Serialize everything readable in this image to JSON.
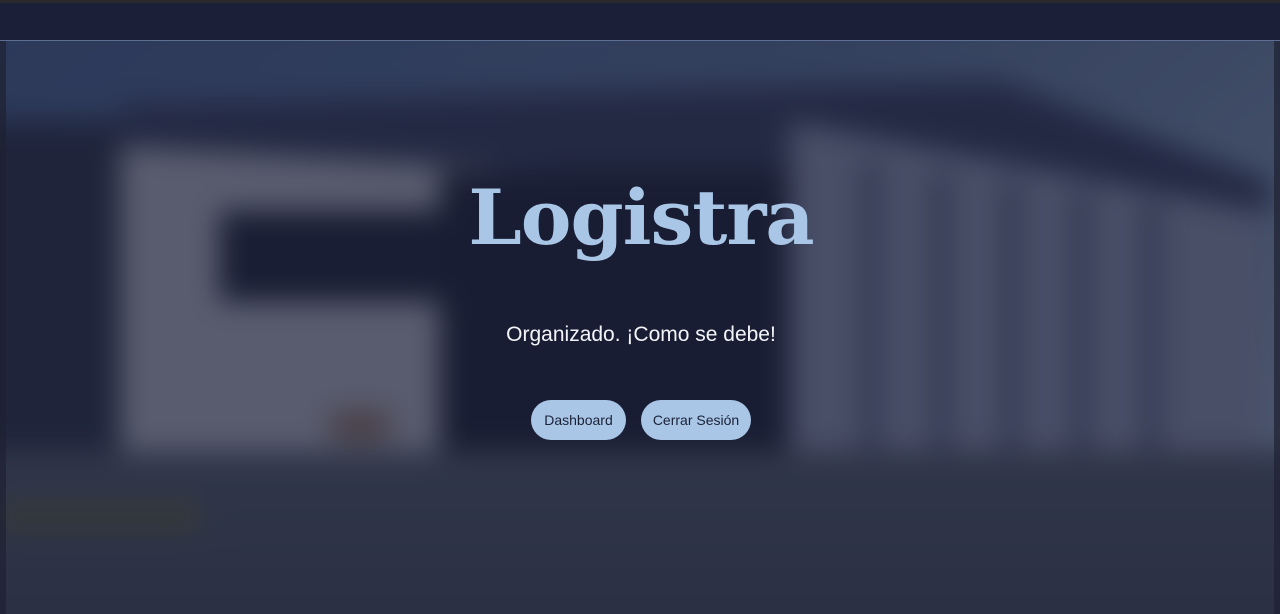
{
  "brand": {
    "title": "Logistra",
    "tagline": "Organizado. ¡Como se debe!"
  },
  "actions": {
    "dashboard_label": "Dashboard",
    "logout_label": "Cerrar Sesión"
  },
  "colors": {
    "navbar_bg": "#1b1f38",
    "accent": "#a9c6e6",
    "button_text": "#1b2238",
    "tagline_text": "#f3f4f8"
  }
}
